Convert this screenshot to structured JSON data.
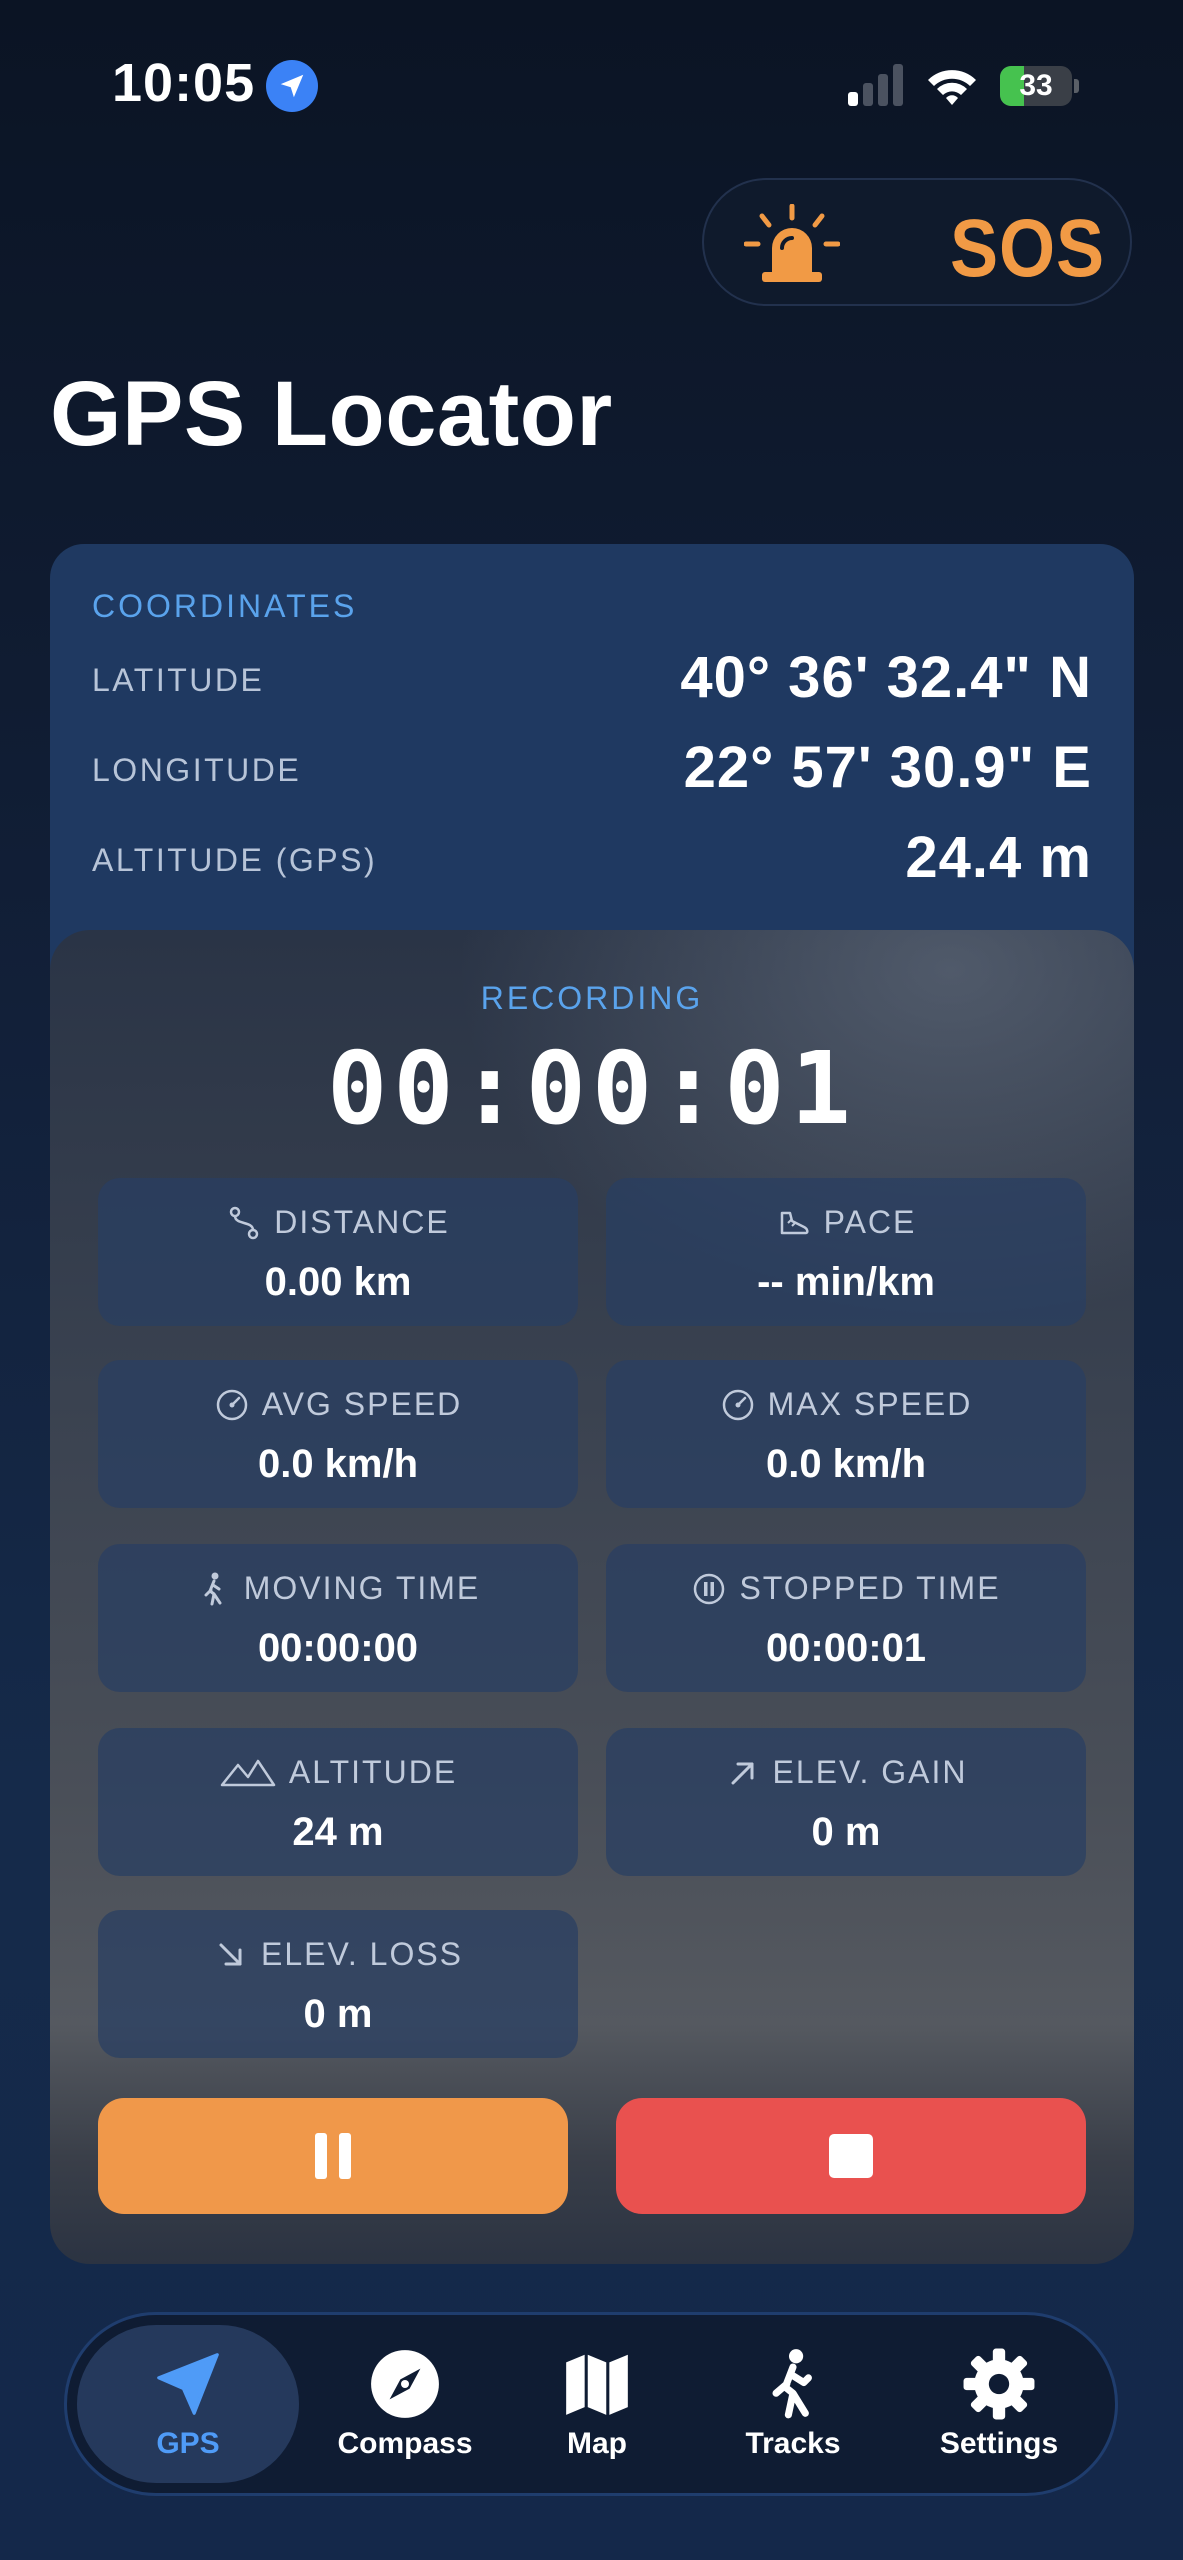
{
  "status_bar": {
    "time": "10:05",
    "battery_level": "33",
    "battery_fraction": 0.33
  },
  "sos": {
    "label": "SOS"
  },
  "page_title": "GPS Locator",
  "coordinates": {
    "title": "COORDINATES",
    "rows": [
      {
        "label": "LATITUDE",
        "value": "40° 36' 32.4\" N"
      },
      {
        "label": "LONGITUDE",
        "value": "22° 57' 30.9\" E"
      },
      {
        "label": "ALTITUDE (GPS)",
        "value": "24.4 m"
      }
    ]
  },
  "recording": {
    "label": "RECORDING",
    "timer": "00:00:01",
    "stats": [
      {
        "icon": "route-icon",
        "label": "DISTANCE",
        "value": "0.00 km"
      },
      {
        "icon": "shoe-icon",
        "label": "PACE",
        "value": "-- min/km"
      },
      {
        "icon": "speedometer-icon",
        "label": "AVG SPEED",
        "value": "0.0 km/h"
      },
      {
        "icon": "speedometer-icon",
        "label": "MAX SPEED",
        "value": "0.0 km/h"
      },
      {
        "icon": "walking-icon",
        "label": "MOVING TIME",
        "value": "00:00:00"
      },
      {
        "icon": "pause-circle-icon",
        "label": "STOPPED TIME",
        "value": "00:00:01"
      },
      {
        "icon": "mountain-icon",
        "label": "ALTITUDE",
        "value": "24 m"
      },
      {
        "icon": "arrow-up-right-icon",
        "label": "ELEV. GAIN",
        "value": "0 m"
      },
      {
        "icon": "arrow-down-right-icon",
        "label": "ELEV. LOSS",
        "value": "0 m"
      }
    ]
  },
  "tabs": [
    {
      "label": "GPS",
      "icon": "location-arrow-icon",
      "active": true
    },
    {
      "label": "Compass",
      "icon": "compass-icon",
      "active": false
    },
    {
      "label": "Map",
      "icon": "map-icon",
      "active": false
    },
    {
      "label": "Tracks",
      "icon": "walking-icon",
      "active": false
    },
    {
      "label": "Settings",
      "icon": "gear-icon",
      "active": false
    }
  ],
  "colors": {
    "accent_blue": "#4f9bf7",
    "sos_orange": "#f19a45",
    "pause_orange": "#f0984a",
    "stop_red": "#e9514f",
    "label_blue": "#5aa3ec"
  }
}
